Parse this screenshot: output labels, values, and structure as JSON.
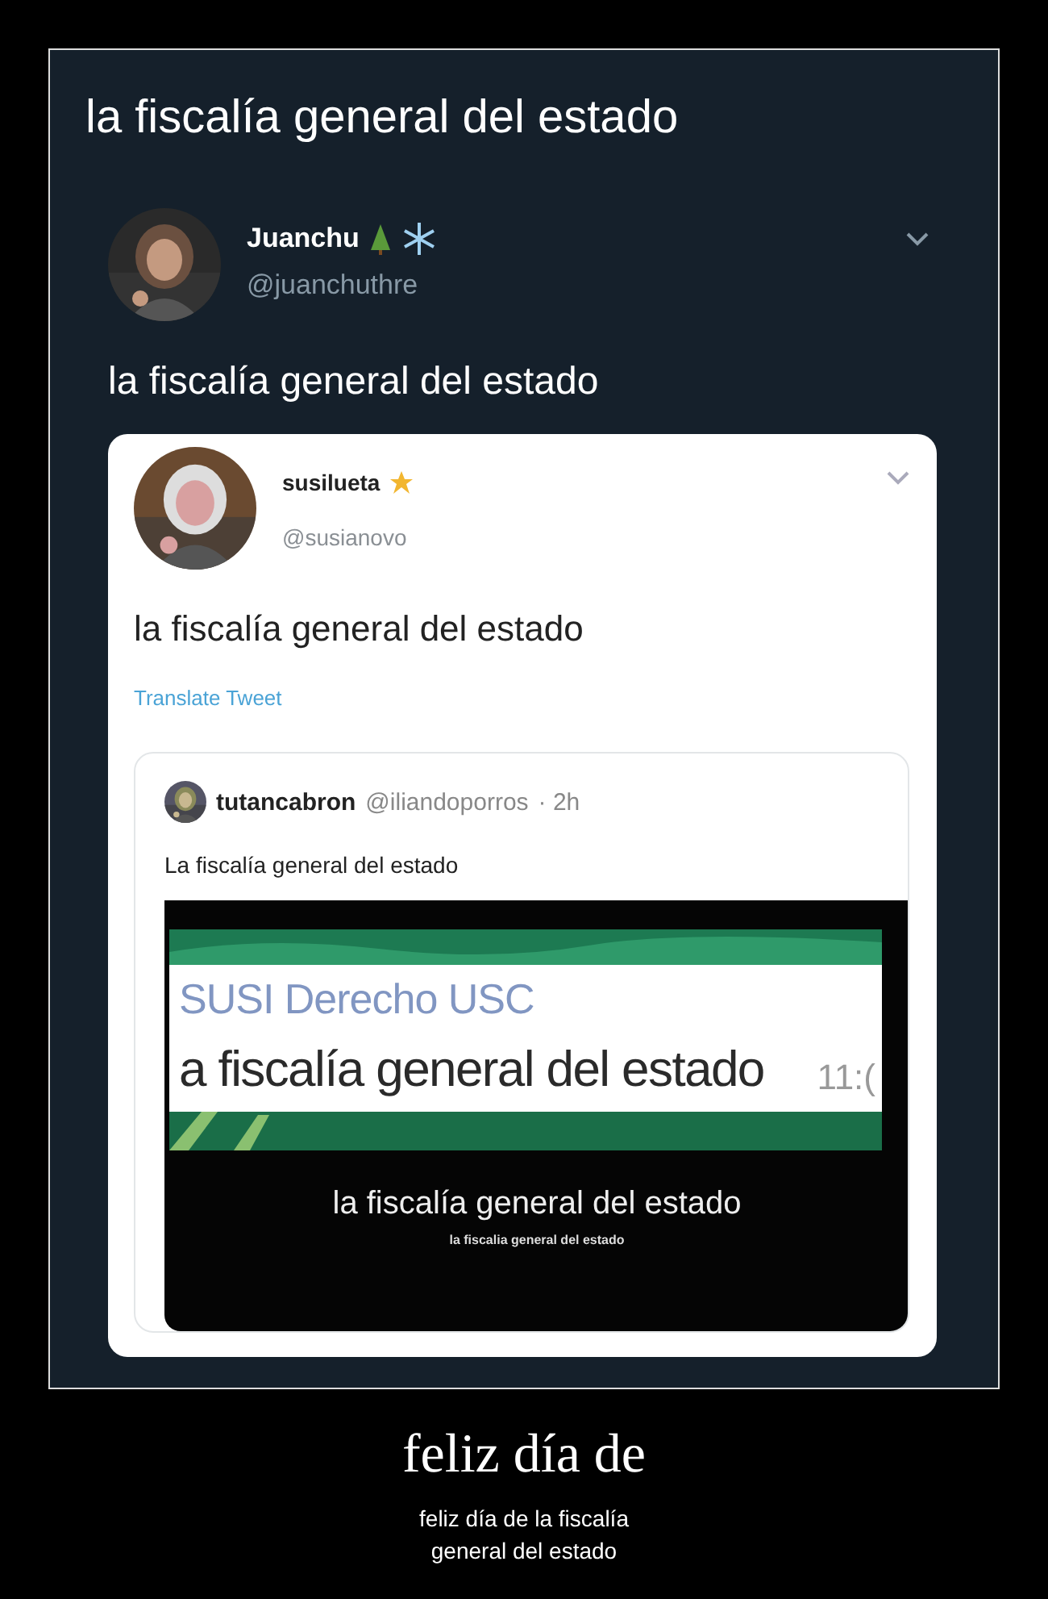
{
  "post": {
    "title": "la fiscalía general del estado"
  },
  "tweet": {
    "name": "Juanchu",
    "handle": "@juanchuthre",
    "text": "la fiscalía general del estado"
  },
  "quoted_tweet": {
    "name": "susilueta",
    "handle": "@susianovo",
    "text": "la fiscalía general del estado",
    "translate_link": "Translate Tweet"
  },
  "inner_quote": {
    "name": "tutancabron",
    "handle": "@iliandoporros",
    "time": "· 2h",
    "text": "La fiscalía general del estado"
  },
  "video_frame": {
    "chat_title": "SUSI Derecho USC",
    "message": "a fiscalía general del estado",
    "time": "11:(",
    "subtitle": "la fiscalía general del estado",
    "subtitle_small": "la fiscalia general del estado"
  },
  "caption": {
    "title": "feliz día de",
    "text": "feliz día de la fiscalía general del estado"
  }
}
